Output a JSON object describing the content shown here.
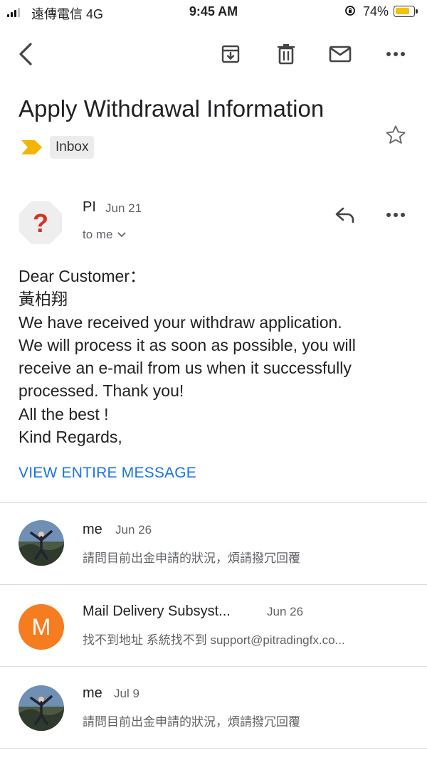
{
  "status_bar": {
    "carrier": "遠傳電信 4G",
    "time": "9:45 AM",
    "battery": "74%",
    "battery_level": 0.74
  },
  "toolbar": {
    "back_icon": "chevron-left-icon",
    "archive_icon": "archive-icon",
    "delete_icon": "trash-icon",
    "mark_unread_icon": "envelope-icon",
    "more_icon": "more-horizontal-icon"
  },
  "email": {
    "subject": "Apply  Withdrawal Information",
    "label": "Inbox",
    "label_color": "#f4b400",
    "sender": "PI",
    "date": "Jun 21",
    "recipient": "to me",
    "avatar_symbol": "?",
    "avatar_color": "#d93025",
    "body_lines": [
      "Dear Customer：",
      "黃柏翔",
      "We have received your withdraw application.",
      "We will process it as soon as possible, you will",
      "receive an e-mail from us when it successfully",
      "processed. Thank you!",
      "All the best !",
      "Kind Regards,"
    ],
    "view_entire": "VIEW ENTIRE MESSAGE"
  },
  "thread": [
    {
      "sender": "me",
      "date": "Jun 26",
      "snippet": "請問目前出金申請的狀況，煩請撥冗回覆",
      "avatar": "photo"
    },
    {
      "sender": "Mail Delivery Subsyst...",
      "date": "Jun 26",
      "snippet": "找不到地址 系統找不到 support@pitradingfx.co...",
      "avatar": "M",
      "avatar_color": "#f57c1f"
    },
    {
      "sender": "me",
      "date": "Jul 9",
      "snippet": "請問目前出金申請的狀況，煩請撥冗回覆",
      "avatar": "photo"
    }
  ]
}
